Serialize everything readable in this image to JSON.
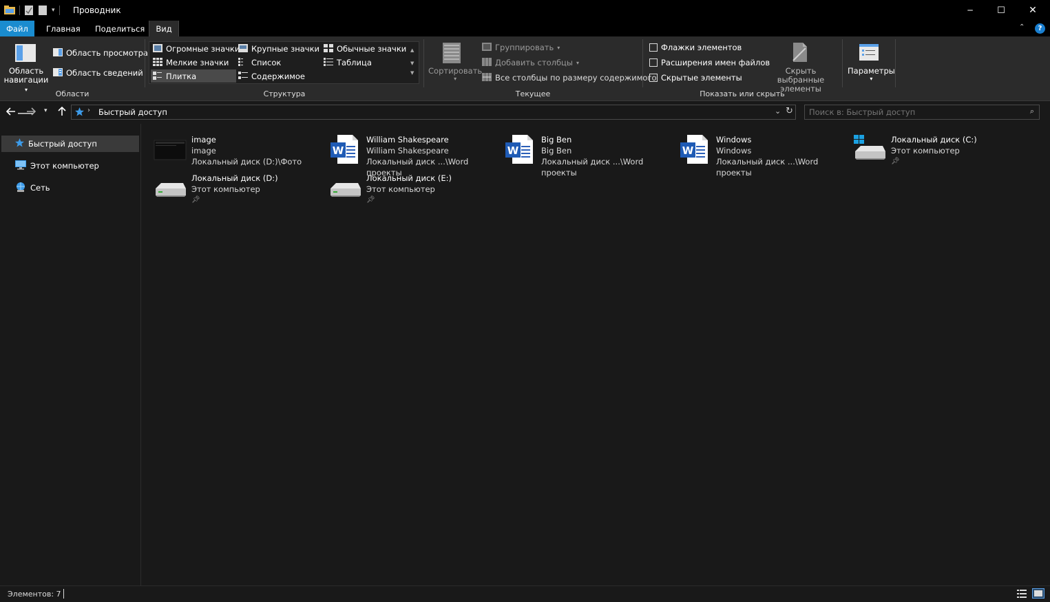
{
  "window": {
    "title": "Проводник",
    "controls": {
      "minimize": "─",
      "maximize": "☐",
      "close": "✕"
    }
  },
  "tabs": {
    "file": "Файл",
    "home": "Главная",
    "share": "Поделиться",
    "view": "Вид"
  },
  "ribbon": {
    "panes": {
      "nav_pane_l1": "Область",
      "nav_pane_l2": "навигации",
      "preview_pane": "Область просмотра",
      "details_pane": "Область сведений",
      "label": "Области"
    },
    "layout": {
      "items": [
        "Огромные значки",
        "Крупные значки",
        "Обычные значки",
        "Мелкие значки",
        "Список",
        "Таблица",
        "Плитка",
        "Содержимое"
      ],
      "selected": "Плитка",
      "label": "Структура"
    },
    "current_view": {
      "sort": "Сортировать",
      "group": "Группировать",
      "add_columns": "Добавить столбцы",
      "size_columns": "Все столбцы по размеру содержимого",
      "label": "Текущее представление"
    },
    "show_hide": {
      "item_checkboxes": "Флажки элементов",
      "file_extensions": "Расширения имен файлов",
      "hidden_items": "Скрытые элементы",
      "hide_selected_l1": "Скрыть выбранные",
      "hide_selected_l2": "элементы",
      "label": "Показать или скрыть"
    },
    "options": {
      "label": "Параметры"
    }
  },
  "address": {
    "path": "Быстрый доступ",
    "search_placeholder": "Поиск в: Быстрый доступ"
  },
  "nav": {
    "quick_access": "Быстрый доступ",
    "this_pc": "Этот компьютер",
    "network": "Сеть"
  },
  "items": [
    {
      "name": "image",
      "line2": "image",
      "line3": "Локальный диск (D:)\\Фото",
      "type": "image"
    },
    {
      "name": "William Shakespeare",
      "line2": "William Shakespeare",
      "line3": "Локальный диск ...\\Word проекты",
      "type": "word"
    },
    {
      "name": "Big Ben",
      "line2": "Big Ben",
      "line3": "Локальный диск ...\\Word проекты",
      "type": "word"
    },
    {
      "name": "Windows",
      "line2": "Windows",
      "line3": "Локальный диск ...\\Word проекты",
      "type": "word"
    },
    {
      "name": "Локальный диск (C:)",
      "line2": "Этот компьютер",
      "line3": "",
      "type": "sysdrive"
    },
    {
      "name": "Локальный диск (D:)",
      "line2": "Этот компьютер",
      "line3": "",
      "type": "drive"
    },
    {
      "name": "Локальный диск (E:)",
      "line2": "Этот компьютер",
      "line3": "",
      "type": "drive"
    }
  ],
  "status": {
    "count": "Элементов: 7"
  },
  "colors": {
    "accent": "#2a8ad4",
    "background": "#191919",
    "ribbon": "#2b2b2b",
    "word_blue": "#1f5bb5"
  }
}
